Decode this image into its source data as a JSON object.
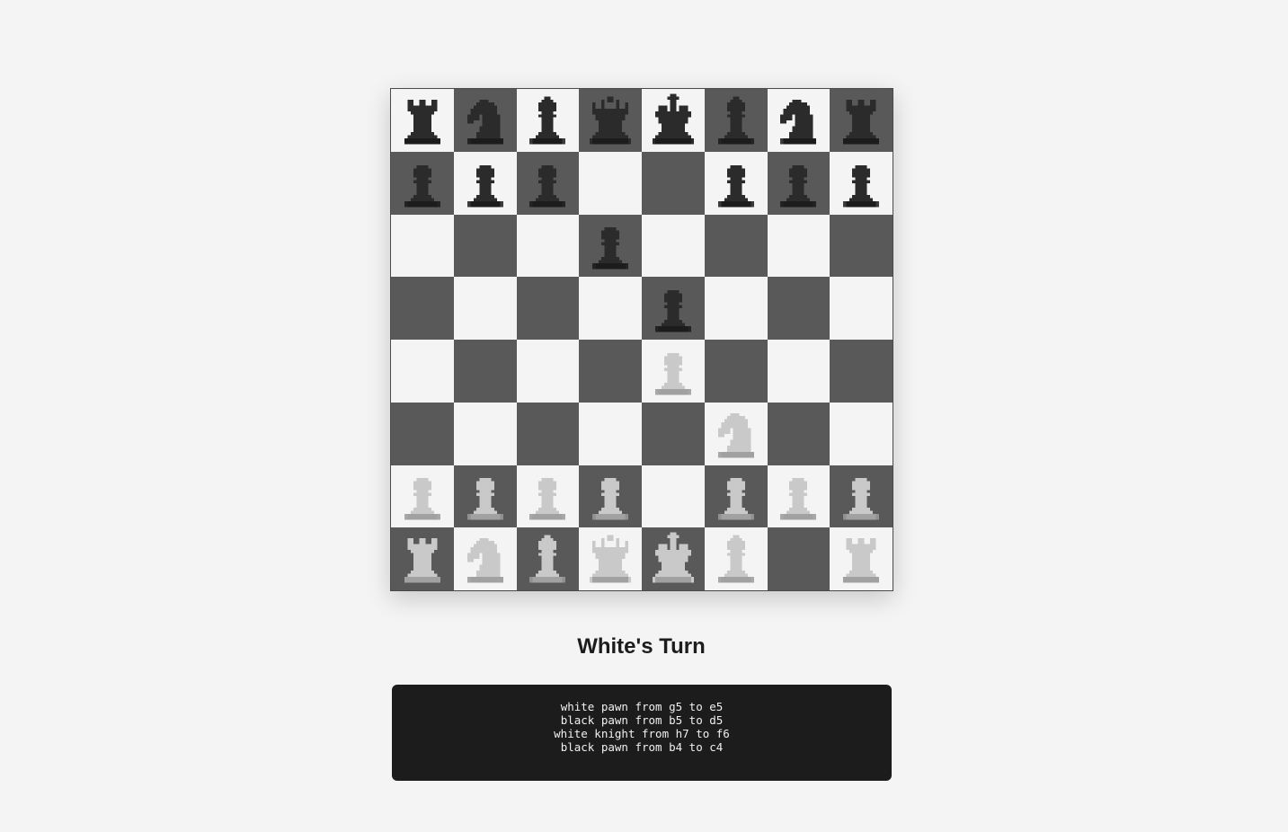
{
  "status": "White's Turn",
  "colors": {
    "light_square": "#f4f4f4",
    "dark_square": "#595959",
    "white_piece_fill": "#c9c9c9",
    "white_piece_shade": "#9a9a9a",
    "black_piece_fill": "#2b2b2b",
    "black_piece_shade": "#1a1a1a"
  },
  "board": [
    [
      "br",
      "bn",
      "bb",
      "bq",
      "bk",
      "bb",
      "bn",
      "br"
    ],
    [
      "bp",
      "bp",
      "bp",
      "",
      "",
      "bp",
      "bp",
      "bp"
    ],
    [
      "",
      "",
      "",
      "bp",
      "",
      "",
      "",
      ""
    ],
    [
      "",
      "",
      "",
      "",
      "bp",
      "",
      "",
      ""
    ],
    [
      "",
      "",
      "",
      "",
      "wp",
      "",
      "",
      ""
    ],
    [
      "",
      "",
      "",
      "",
      "",
      "wn",
      "",
      ""
    ],
    [
      "wp",
      "wp",
      "wp",
      "wp",
      "",
      "wp",
      "wp",
      "wp"
    ],
    [
      "wr",
      "wn",
      "wb",
      "wq",
      "wk",
      "wb",
      "",
      "wr"
    ]
  ],
  "move_log": [
    "white pawn from g5 to e5",
    "black pawn from b5 to d5",
    "white knight from h7 to f6",
    "black pawn from b4 to c4"
  ]
}
